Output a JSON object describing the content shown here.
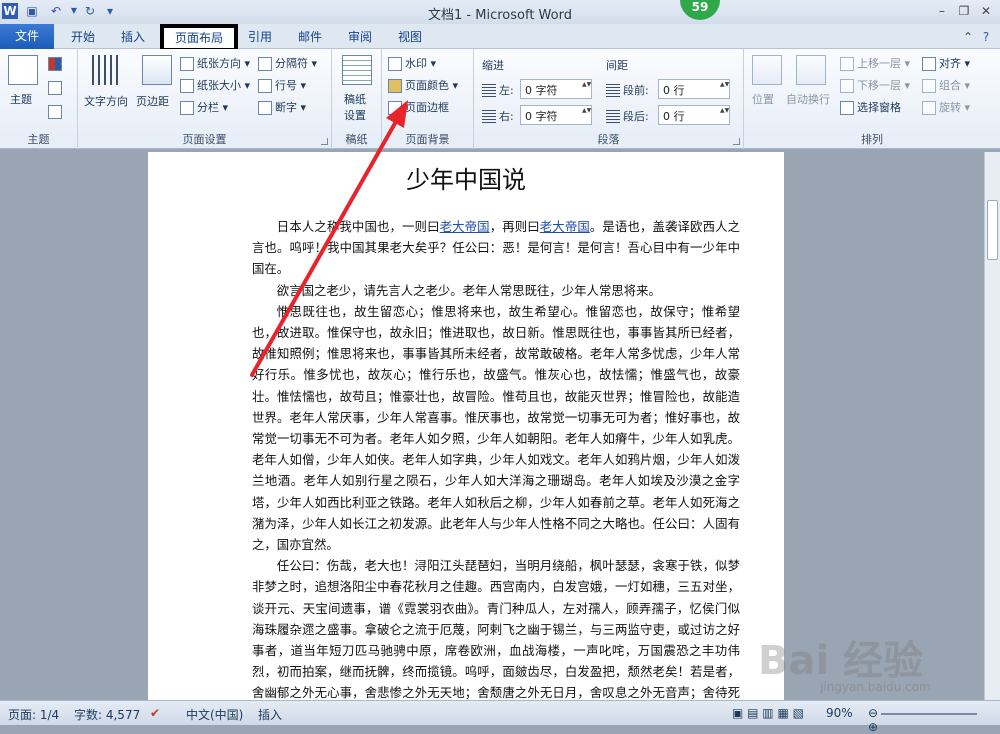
{
  "window": {
    "title": "文档1 - Microsoft Word",
    "badge": "59"
  },
  "tabs": [
    "文件",
    "开始",
    "插入",
    "页面布局",
    "引用",
    "邮件",
    "审阅",
    "视图"
  ],
  "ribbon": {
    "theme": {
      "label": "主题",
      "button": "主题"
    },
    "page_setup": {
      "label": "页面设置",
      "text_direction": "文字方向",
      "margins": "页边距",
      "orientation": "纸张方向",
      "size": "纸张大小",
      "columns": "分栏",
      "breaks": "分隔符",
      "line_numbers": "行号",
      "hyphenation": "断字"
    },
    "manuscript": {
      "label": "稿纸",
      "button_line1": "稿纸",
      "button_line2": "设置"
    },
    "page_background": {
      "label": "页面背景",
      "watermark": "水印",
      "page_color": "页面颜色",
      "page_borders": "页面边框"
    },
    "paragraph": {
      "label": "段落",
      "indent": "缩进",
      "spacing": "间距",
      "left": "左:",
      "right": "右:",
      "before": "段前:",
      "after": "段后:",
      "left_value": "0 字符",
      "right_value": "0 字符",
      "before_value": "0 行",
      "after_value": "0 行"
    },
    "arrange": {
      "label": "排列",
      "position": "位置",
      "wrap": "自动换行",
      "bring_forward": "上移一层",
      "send_backward": "下移一层",
      "selection_pane": "选择窗格",
      "align": "对齐",
      "group": "组合",
      "rotate": "旋转"
    }
  },
  "document": {
    "title": "少年中国说",
    "p1_a": "日本人之称我中国也，一则曰",
    "p1_link1": "老大帝国",
    "p1_b": "，再则曰",
    "p1_link2": "老大帝国",
    "p1_c": "。是语也，盖袭译欧西人之言也。呜呼！我中国其果老大矣乎？任公曰：恶！是何言！是何言！吾心目中有一少年中国在。",
    "p2": "欲言国之老少，请先言人之老少。老年人常思既往，少年人常思将来。",
    "p3": "惟思既往也，故生留恋心；惟思将来也，故生希望心。惟留恋也，故保守；惟希望也，故进取。惟保守也，故永旧；惟进取也，故日新。惟思既往也，事事皆其所已经者，故惟知照例；惟思将来也，事事皆其所未经者，故常敢破格。老年人常多忧虑，少年人常好行乐。惟多忧也，故灰心；惟行乐也，故盛气。惟灰心也，故怯懦；惟盛气也，故豪壮。惟怯懦也，故苟且；惟豪壮也，故冒险。惟苟且也，故能灭世界；惟冒险也，故能造世界。老年人常厌事，少年人常喜事。惟厌事也，故常觉一切事无可为者；惟好事也，故常觉一切事无不可为者。老年人如夕照，少年人如朝阳。老年人如瘠牛，少年人如乳虎。老年人如僧，少年人如侠。老年人如字典，少年人如戏文。老年人如鸦片烟，少年人如泼兰地酒。老年人如别行星之陨石，少年人如大洋海之珊瑚岛。老年人如埃及沙漠之金字塔，少年人如西比利亚之铁路。老年人如秋后之柳，少年人如春前之草。老年人如死海之潴为泽，少年人如长江之初发源。此老年人与少年人性格不同之大略也。任公曰：人固有之，国亦宜然。",
    "p4": "任公曰：伤哉，老大也！浔阳江头琵琶妇，当明月绕船，枫叶瑟瑟，衾寒于铁，似梦非梦之时，追想洛阳尘中春花秋月之佳趣。西宫南内，白发宫娥，一灯如穗，三五对坐，谈开元、天宝间遗事，谱《霓裳羽衣曲》。青门种瓜人，左对孺人，顾弄孺子，忆侯门似海珠履杂遝之盛事。拿破仑之流于厄蔑，阿剌飞之幽于锡兰，与三两监守吏，或过访之好事者，道当年短刀匹马驰骋中原，席卷欧洲，血战海楼，一声叱咤，万国震恐之丰功伟烈，初而拍案，继而抚髀，终而揽镜。呜呼，面皴齿尽，白发盈把，颓然老矣！若是者，舍幽郁之外无心事，舍悲惨之外无天地；舍颓唐之外无日月，舍叹息之外无音声；舍待死之外无事业。美人豪杰且然，而况寻常碌碌者耶？生平亲友，皆在墟墓；起居饮食，待命于人。今日且过，"
  },
  "status": {
    "page": "页面: 1/4",
    "words": "字数: 4,577",
    "lang": "中文(中国)",
    "mode": "插入",
    "zoom": "90%"
  },
  "watermark": {
    "brand": "Bai 经验",
    "url": "jingyan.baidu.com"
  },
  "colors": {
    "file_tab": "#2b6cc4",
    "arrow": "#e8232b",
    "badge": "#2ea84a"
  }
}
